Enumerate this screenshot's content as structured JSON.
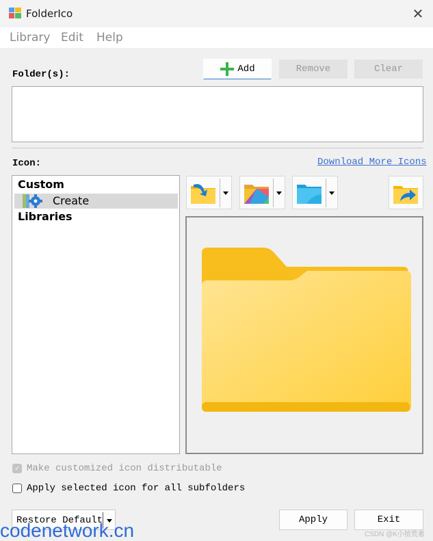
{
  "window": {
    "title": "FolderIco",
    "close_glyph": "✕"
  },
  "menu": {
    "items": [
      "Library",
      "Edit",
      "Help"
    ]
  },
  "folders": {
    "label": "Folder(s):",
    "add_label": "Add",
    "remove_label": "Remove",
    "clear_label": "Clear"
  },
  "icon_section": {
    "label": "Icon:",
    "download_link": "Download More Icons",
    "tree": {
      "groups": [
        "Custom",
        "Libraries"
      ],
      "custom_items": [
        "Create"
      ]
    },
    "toolbar_icons": [
      "import-folder-icon",
      "colorful-folder-icon",
      "blue-folder-icon",
      "share-folder-icon"
    ]
  },
  "options": {
    "distributable_label": "Make customized icon distributable",
    "distributable_checked": true,
    "distributable_enabled": false,
    "subfolders_label": "Apply selected icon for all subfolders",
    "subfolders_checked": false
  },
  "footer": {
    "restore_label": "Restore Default",
    "apply_label": "Apply",
    "exit_label": "Exit"
  },
  "overlays": {
    "watermark": "codenetwork.cn",
    "csdn_mark": "CSDN @K小拾荒者"
  },
  "colors": {
    "accent_green": "#3bb34a",
    "link_blue": "#3a6fcf",
    "folder_yellow": "#ffd24a"
  }
}
